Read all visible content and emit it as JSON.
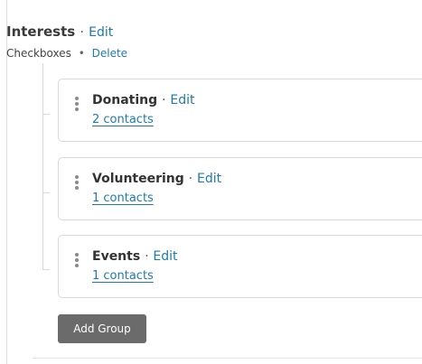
{
  "section": {
    "title": "Interests",
    "separator": "·",
    "edit_label": "Edit",
    "type_label": "Checkboxes",
    "type_separator": "•",
    "delete_label": "Delete"
  },
  "groups": [
    {
      "name": "Donating",
      "edit_label": "Edit",
      "count_label": "2 contacts"
    },
    {
      "name": "Volunteering",
      "edit_label": "Edit",
      "count_label": "1 contacts"
    },
    {
      "name": "Events",
      "edit_label": "Edit",
      "count_label": "1 contacts"
    }
  ],
  "add_group_label": "Add Group",
  "colors": {
    "link": "#1d7ab0",
    "button_bg": "#6b6b6b",
    "border": "#d9d9d9"
  },
  "icons": {
    "card_menu": "kebab-menu-icon"
  }
}
